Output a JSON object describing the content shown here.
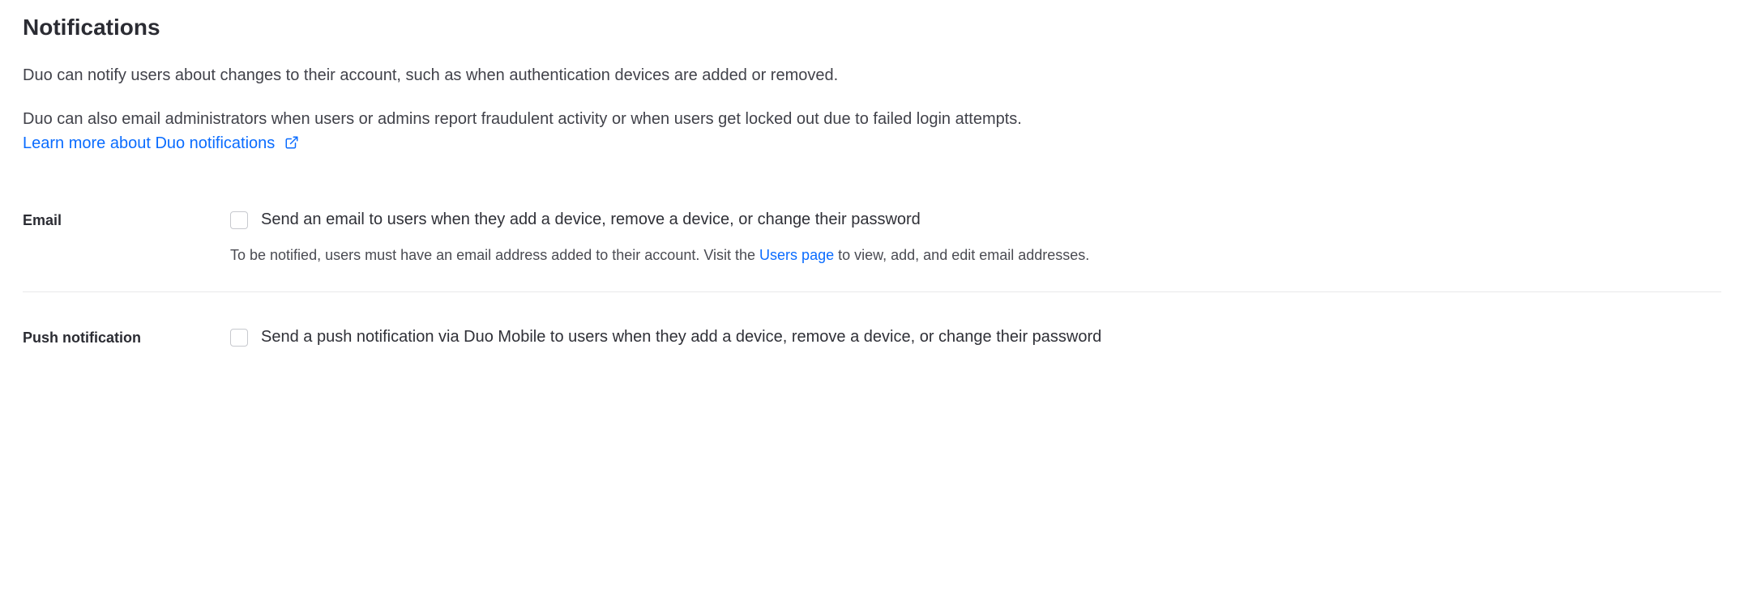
{
  "section": {
    "title": "Notifications",
    "intro1": "Duo can notify users about changes to their account, such as when authentication devices are added or removed.",
    "intro2": "Duo can also email administrators when users or admins report fraudulent activity or when users get locked out due to failed login attempts.",
    "learn_more": "Learn more about Duo notifications"
  },
  "settings": {
    "email": {
      "label": "Email",
      "checkbox_label": "Send an email to users when they add a device, remove a device, or change their password",
      "helper_pre": "To be notified, users must have an email address added to their account. Visit the ",
      "helper_link": "Users page",
      "helper_post": " to view, add, and edit email addresses."
    },
    "push": {
      "label": "Push notification",
      "checkbox_label": "Send a push notification via Duo Mobile to users when they add a device, remove a device, or change their password"
    }
  }
}
